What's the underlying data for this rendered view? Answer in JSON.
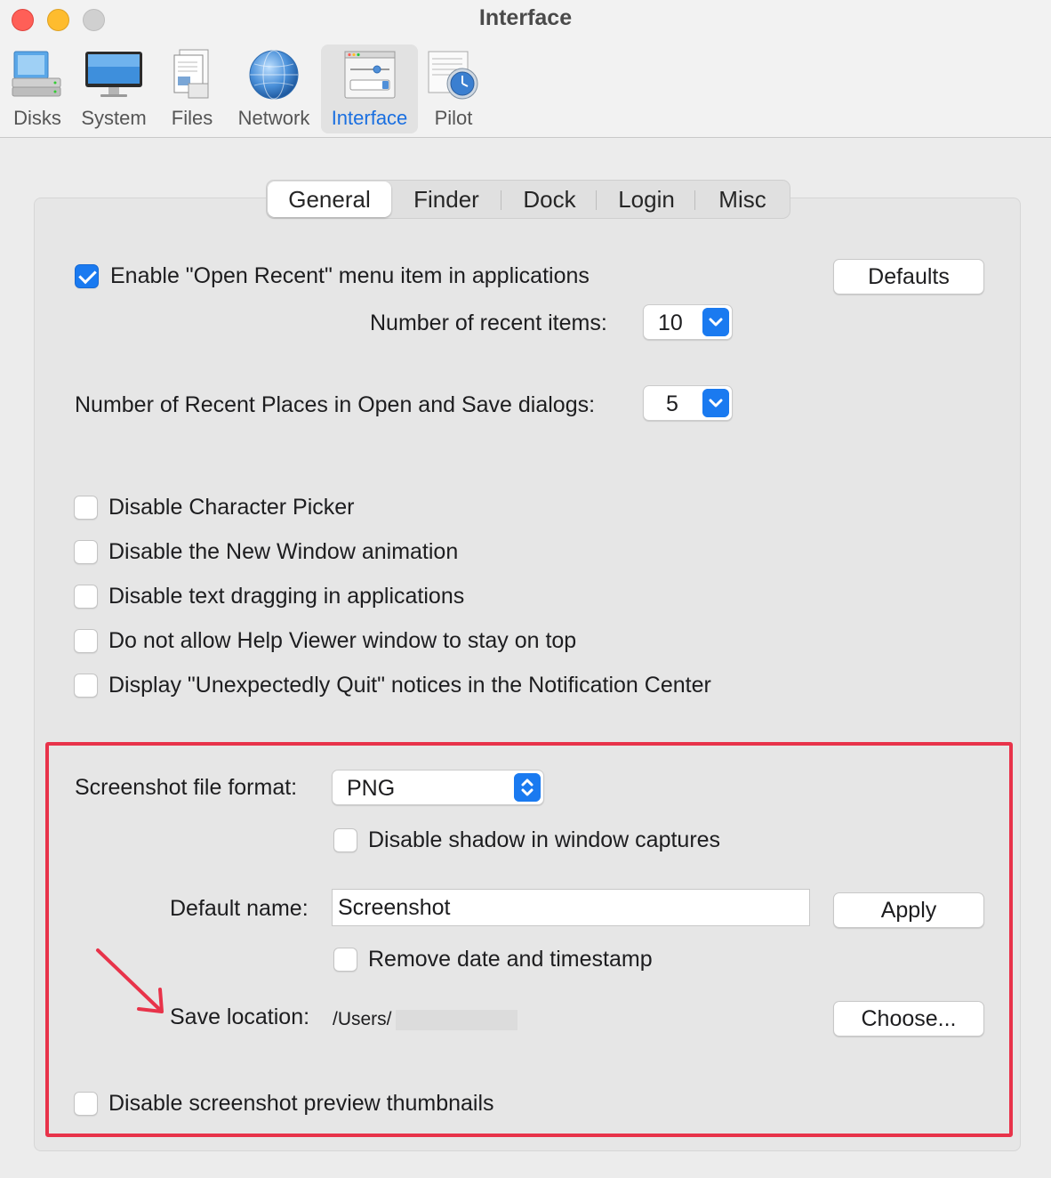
{
  "window": {
    "title": "Interface"
  },
  "toolbar": {
    "items": [
      {
        "label": "Disks",
        "icon": "disks-icon"
      },
      {
        "label": "System",
        "icon": "system-monitor-icon"
      },
      {
        "label": "Files",
        "icon": "files-icon"
      },
      {
        "label": "Network",
        "icon": "network-globe-icon"
      },
      {
        "label": "Interface",
        "icon": "interface-icon",
        "selected": true
      },
      {
        "label": "Pilot",
        "icon": "pilot-clock-icon"
      }
    ]
  },
  "tabs": [
    {
      "label": "General",
      "selected": true
    },
    {
      "label": "Finder"
    },
    {
      "label": "Dock"
    },
    {
      "label": "Login"
    },
    {
      "label": "Misc"
    }
  ],
  "general": {
    "open_recent_label": "Enable \"Open Recent\" menu item in applications",
    "open_recent_checked": true,
    "defaults_button": "Defaults",
    "recent_items_label": "Number of recent items:",
    "recent_items_value": "10",
    "recent_places_label": "Number of Recent Places in Open and Save dialogs:",
    "recent_places_value": "5",
    "options": [
      {
        "label": "Disable Character Picker",
        "checked": false
      },
      {
        "label": "Disable the New Window animation",
        "checked": false
      },
      {
        "label": "Disable text dragging in applications",
        "checked": false
      },
      {
        "label": "Do not allow Help Viewer window to stay on top",
        "checked": false
      },
      {
        "label": "Display \"Unexpectedly Quit\" notices in the Notification Center",
        "checked": false
      }
    ]
  },
  "screenshot": {
    "format_label": "Screenshot file format:",
    "format_value": "PNG",
    "disable_shadow_label": "Disable shadow in window captures",
    "default_name_label": "Default name:",
    "default_name_value": "Screenshot",
    "apply_button": "Apply",
    "remove_timestamp_label": "Remove date and timestamp",
    "save_location_label": "Save location:",
    "save_location_value": "/Users/",
    "choose_button": "Choose...",
    "disable_thumbnails_label": "Disable screenshot preview thumbnails"
  },
  "annotation_color": "#e8334a",
  "accent_color": "#1a7af0"
}
